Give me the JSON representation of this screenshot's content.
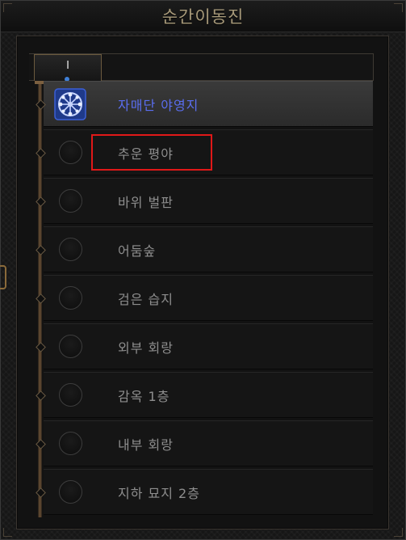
{
  "window": {
    "title": "순간이동진"
  },
  "tabs": [
    {
      "label": "I",
      "active": true
    }
  ],
  "locations": [
    {
      "name": "자매단 야영지",
      "selected": true,
      "icon": "portal-waypoint-icon"
    },
    {
      "name": "추운 평야",
      "selected": false,
      "icon": "empty-waypoint-icon"
    },
    {
      "name": "바위 벌판",
      "selected": false,
      "icon": "empty-waypoint-icon"
    },
    {
      "name": "어둠숲",
      "selected": false,
      "icon": "empty-waypoint-icon"
    },
    {
      "name": "검은 습지",
      "selected": false,
      "icon": "empty-waypoint-icon"
    },
    {
      "name": "외부 회랑",
      "selected": false,
      "icon": "empty-waypoint-icon"
    },
    {
      "name": "감옥 1층",
      "selected": false,
      "icon": "empty-waypoint-icon"
    },
    {
      "name": "내부 회랑",
      "selected": false,
      "icon": "empty-waypoint-icon"
    },
    {
      "name": "지하 묘지 2층",
      "selected": false,
      "icon": "empty-waypoint-icon"
    }
  ],
  "annotation": {
    "highlighted_item": "추운 평야",
    "color": "#e01818"
  },
  "colors": {
    "selected_text": "#5a6ef0",
    "normal_text": "#8e8e8e",
    "title": "#a89a7a"
  }
}
